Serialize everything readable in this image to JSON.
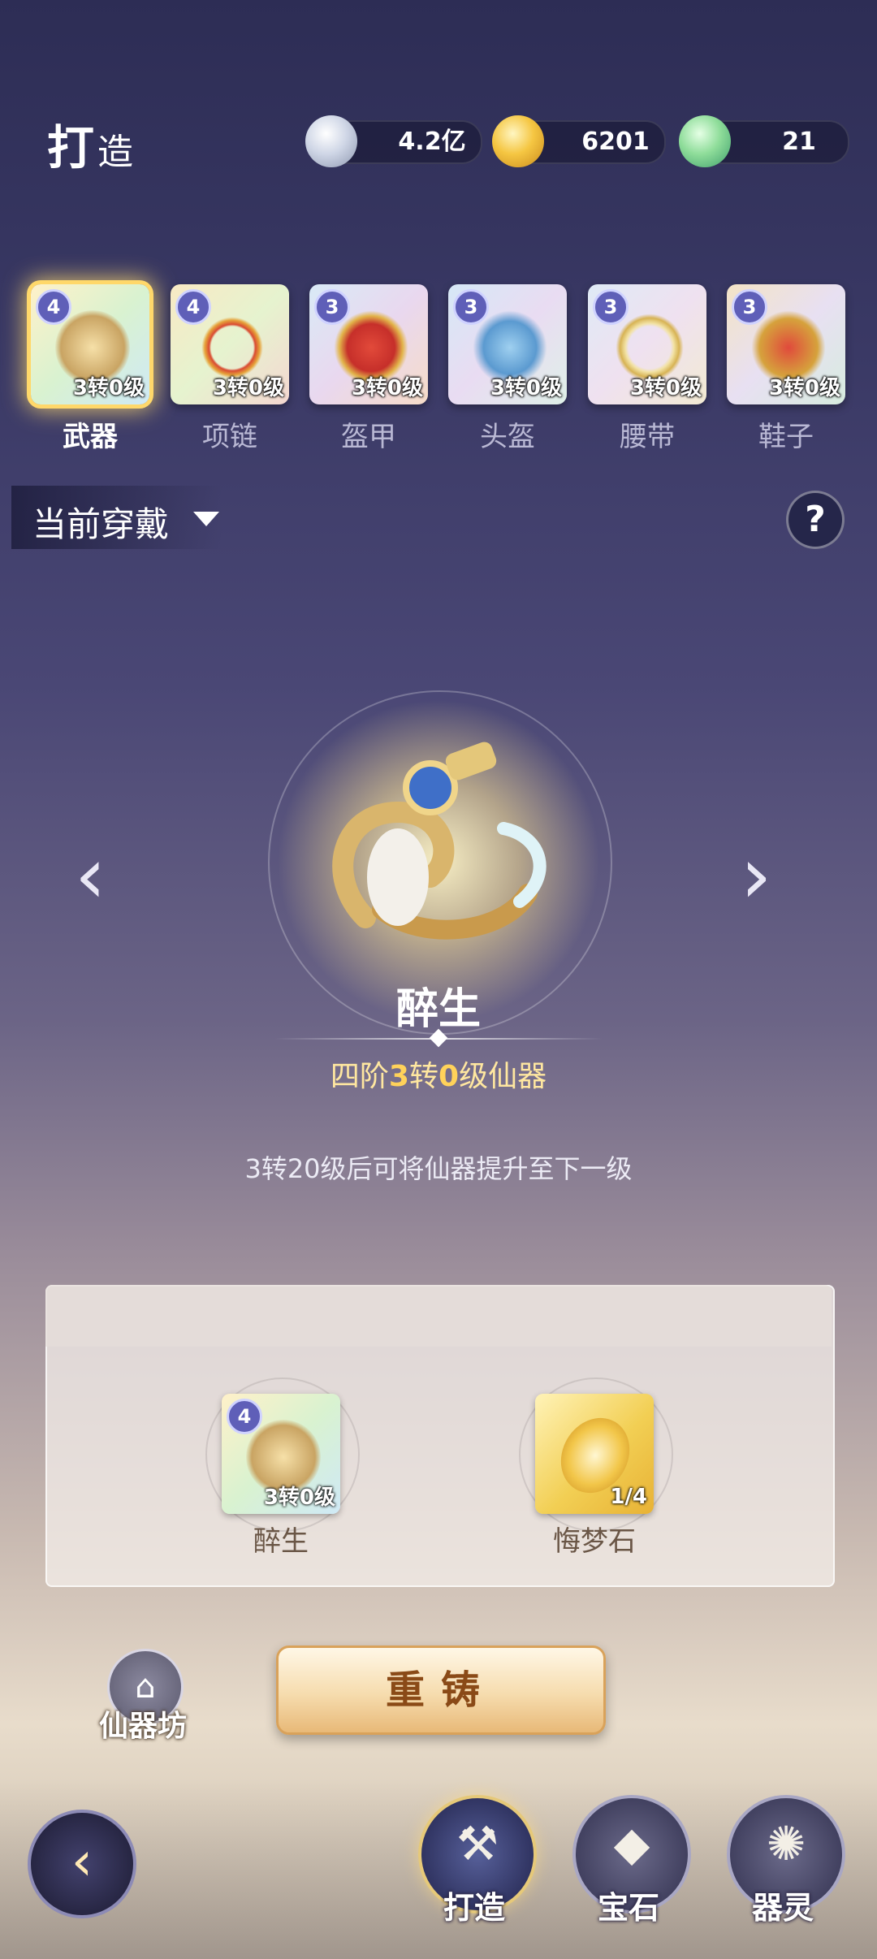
{
  "header": {
    "title_main": "打",
    "title_sub": "造",
    "currencies": [
      {
        "icon": "silver-ingot-icon",
        "value": "4.2亿"
      },
      {
        "icon": "gold-ingot-icon",
        "value": "6201"
      },
      {
        "icon": "jade-cloud-icon",
        "value": "21"
      }
    ]
  },
  "tabs": [
    {
      "label": "武器",
      "tier": "4",
      "level": "3转0级",
      "active": true
    },
    {
      "label": "项链",
      "tier": "4",
      "level": "3转0级",
      "active": false
    },
    {
      "label": "盔甲",
      "tier": "3",
      "level": "3转0级",
      "active": false
    },
    {
      "label": "头盔",
      "tier": "3",
      "level": "3转0级",
      "active": false
    },
    {
      "label": "腰带",
      "tier": "3",
      "level": "3转0级",
      "active": false
    },
    {
      "label": "鞋子",
      "tier": "3",
      "level": "3转0级",
      "active": false
    }
  ],
  "filter": {
    "label": "当前穿戴"
  },
  "help": {
    "label": "?"
  },
  "item": {
    "name": "醉生",
    "grade_prefix": "四阶",
    "grade_turn": "3",
    "grade_turn_unit": "转",
    "grade_level": "0",
    "grade_suffix": "级仙器",
    "hint": "3转20级后可将仙器提升至下一级"
  },
  "materials": [
    {
      "name": "醉生",
      "tier": "4",
      "level": "3转0级"
    },
    {
      "name": "悔梦石",
      "count": "1/4"
    }
  ],
  "actions": {
    "shop_label": "仙器坊",
    "recast_label": "重铸"
  },
  "nav": [
    {
      "label": "打造",
      "icon": "hammer-anvil-icon",
      "active": true
    },
    {
      "label": "宝石",
      "icon": "gem-icon",
      "active": false
    },
    {
      "label": "器灵",
      "icon": "spirit-flame-icon",
      "active": false
    }
  ]
}
